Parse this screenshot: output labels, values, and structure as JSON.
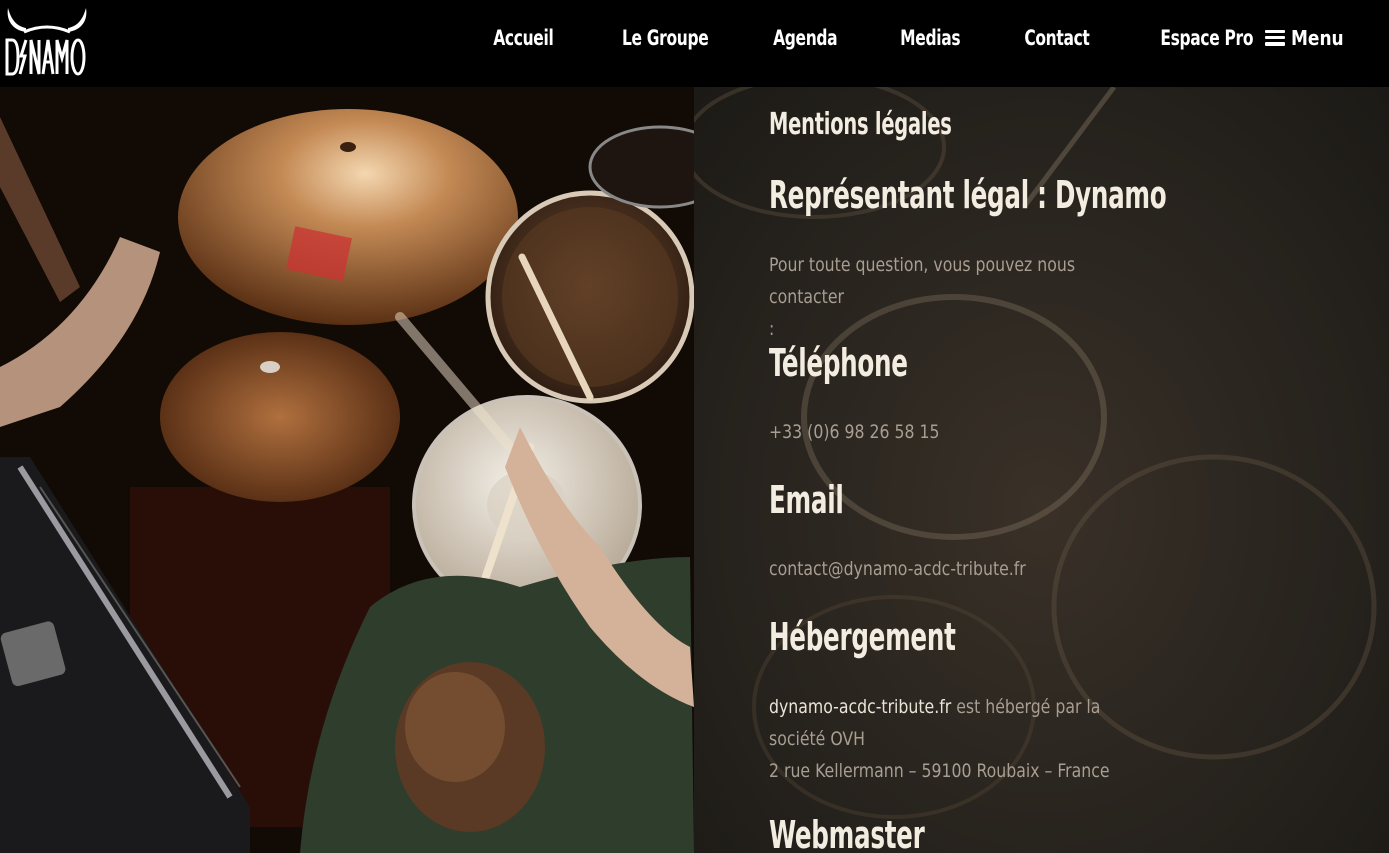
{
  "logo": {
    "text": "DYNAMO",
    "icon": "horns-icon"
  },
  "nav": {
    "items": [
      "Accueil",
      "Le Groupe",
      "Agenda",
      "Medias",
      "Contact",
      "Espace Pro"
    ],
    "menu_label": "Menu"
  },
  "content": {
    "page_title": "Mentions légales",
    "representant": {
      "heading": "Représentant légal : Dynamo",
      "text_line1": "Pour toute question, vous pouvez nous contacter",
      "text_line2": ":"
    },
    "telephone": {
      "heading": "Téléphone",
      "value": "+33 (0)6 98 26 58 15"
    },
    "email": {
      "heading": "Email",
      "value": "contact@dynamo-acdc-tribute.fr"
    },
    "hebergement": {
      "heading": "Hébergement",
      "site": "dynamo-acdc-tribute.fr",
      "line1_rest": " est hébergé par la",
      "line2": "société OVH",
      "line3": "2 rue Kellermann – 59100 Roubaix – France"
    },
    "webmaster": {
      "heading": "Webmaster"
    }
  },
  "colors": {
    "header_bg": "#000000",
    "heading": "#f3ece0",
    "body_text": "#a89e92"
  }
}
